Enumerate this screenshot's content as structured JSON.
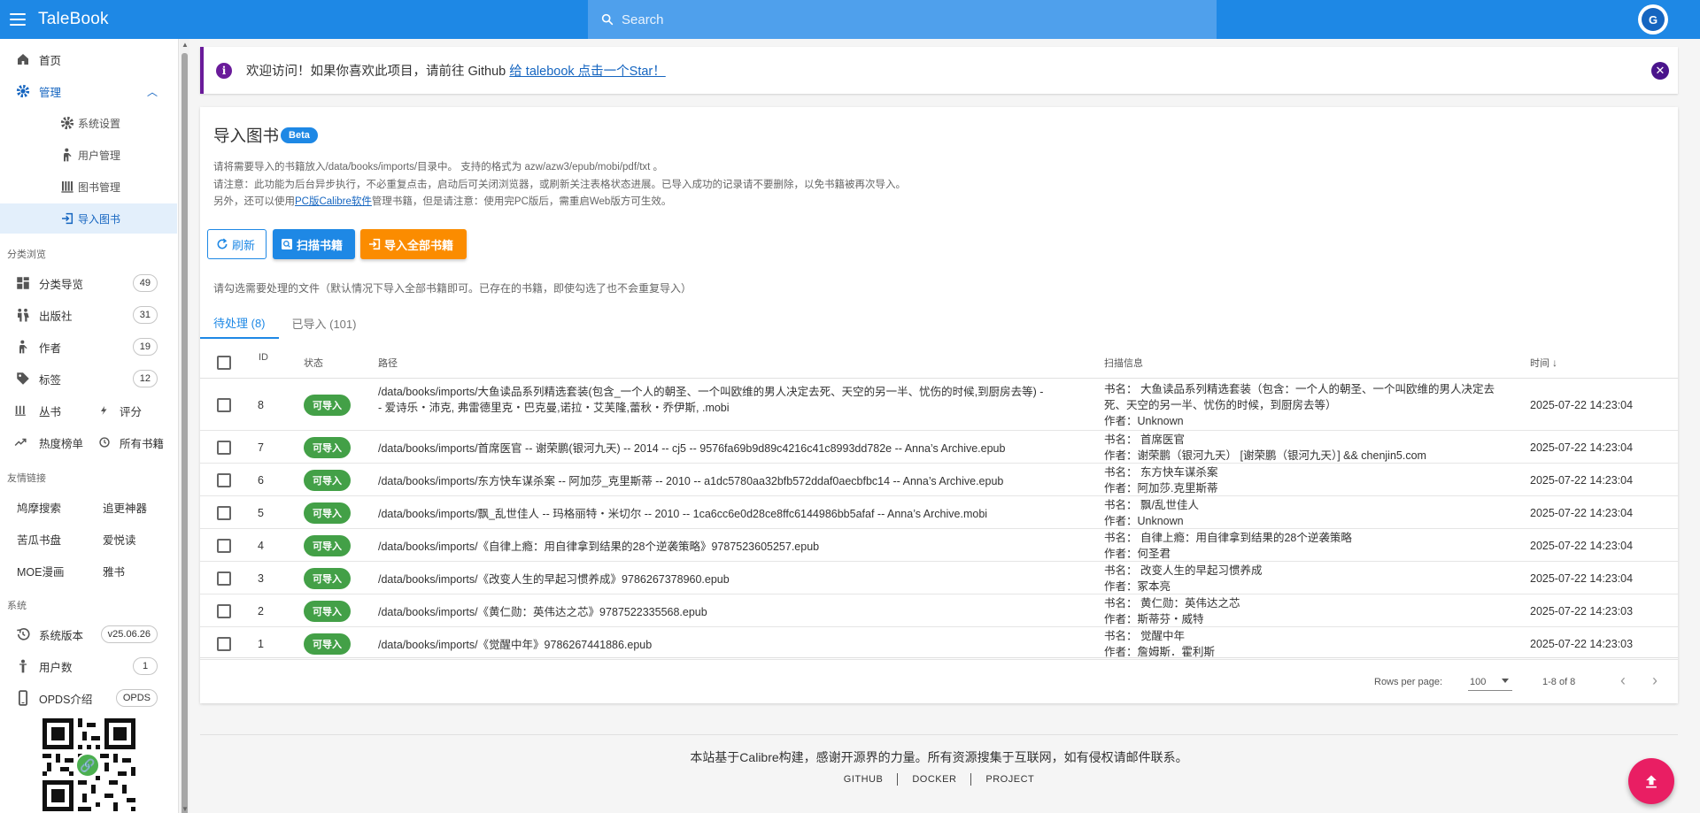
{
  "topbar": {
    "brand": "TaleBook",
    "search_placeholder": "Search",
    "avatar_letter": "G"
  },
  "sidebar": {
    "home": "首页",
    "manage": "管理",
    "manage_sub": [
      "系统设置",
      "用户管理",
      "图书管理",
      "导入图书"
    ],
    "section_browse": "分类浏览",
    "browse": [
      {
        "label": "分类导览",
        "count": "49"
      },
      {
        "label": "出版社",
        "count": "31"
      },
      {
        "label": "作者",
        "count": "19"
      },
      {
        "label": "标签",
        "count": "12"
      }
    ],
    "congshu": "丛书",
    "pingfen": "评分",
    "rebang": "热度榜单",
    "all_books": "所有书籍",
    "section_friends": "友情链接",
    "friends": [
      "鸠摩搜索",
      "追更神器",
      "苦瓜书盘",
      "爱悦读",
      "MOE漫画",
      "雅书"
    ],
    "section_system": "系统",
    "system": [
      {
        "label": "系统版本",
        "badge": "v25.06.26"
      },
      {
        "label": "用户数",
        "badge": "1"
      },
      {
        "label": "OPDS介绍",
        "badge": "OPDS"
      }
    ]
  },
  "alert": {
    "text": "欢迎访问！如果你喜欢此项目，请前往 Github ",
    "link": "给 talebook 点击一个Star！"
  },
  "import": {
    "title": "导入图书",
    "badge": "Beta",
    "desc1": "请将需要导入的书籍放入/data/books/imports/目录中。 支持的格式为 azw/azw3/epub/mobi/pdf/txt 。",
    "desc2": "请注意：此功能为后台异步执行，不必重复点击，启动后可关闭浏览器，或刷新关注表格状态进展。已导入成功的记录请不要删除，以免书籍被再次导入。",
    "desc3_pre": "另外，还可以使用",
    "desc3_link": "PC版Calibre软件",
    "desc3_post": "管理书籍，但是请注意：使用完PC版后，需重启Web版方可生效。",
    "btn_refresh": "刷新",
    "btn_scan": "扫描书籍",
    "btn_import_all": "导入全部书籍",
    "hint": "请勾选需要处理的文件（默认情况下导入全部书籍即可。已存在的书籍，即使勾选了也不会重复导入）",
    "tab_pending": "待处理 (8)",
    "tab_done": "已导入 (101)",
    "headers": {
      "id": "ID",
      "status": "状态",
      "path": "路径",
      "scan": "扫描信息",
      "time": "时间"
    },
    "rows": [
      {
        "id": "8",
        "status": "可导入",
        "path1": "/data/books/imports/大鱼读品系列精选套装(包含_一个人的朝圣、一个叫欧维的男人决定去死、天空的另一半、忧伤的时候,到厨房去等) -",
        "path2": "- 爱诗乐・沛克, 弗雷德里克・巴克曼,诺拉・艾芙隆,蕾秋・乔伊斯, .mobi",
        "scan1": "书名： 大鱼读品系列精选套装（包含：一个人的朝圣、一个叫欧维的男人决定去",
        "scan2": "死、天空的另一半、忧伤的时候，到厨房去等）",
        "scan3": "作者：Unknown",
        "time": "2025-07-22 14:23:04"
      },
      {
        "id": "7",
        "status": "可导入",
        "path1": "/data/books/imports/首席医官 -- 谢荣鹏(银河九天) -- 2014 -- cj5 -- 9576fa69b9d89c4216c41c8993dd782e -- Anna’s Archive.epub",
        "scan1": "书名： 首席医官",
        "scan2": "作者：谢荣鹏（银河九天） [谢荣鹏（银河九天）] && chenjin5.com",
        "time": "2025-07-22 14:23:04"
      },
      {
        "id": "6",
        "status": "可导入",
        "path1": "/data/books/imports/东方快车谋杀案 -- 阿加莎_克里斯蒂 -- 2010 -- a1dc5780aa32bfb572ddaf0aecbfbc14 -- Anna’s Archive.epub",
        "scan1": "书名： 东方快车谋杀案",
        "scan2": "作者：阿加莎.克里斯蒂",
        "time": "2025-07-22 14:23:04"
      },
      {
        "id": "5",
        "status": "可导入",
        "path1": "/data/books/imports/飘_乱世佳人 -- 玛格丽特・米切尔 -- 2010 -- 1ca6cc6e0d28ce8ffc6144986bb5afaf -- Anna’s Archive.mobi",
        "scan1": "书名： 飘/乱世佳人",
        "scan2": "作者：Unknown",
        "time": "2025-07-22 14:23:04"
      },
      {
        "id": "4",
        "status": "可导入",
        "path1": "/data/books/imports/《自律上瘾：用自律拿到结果的28个逆袭策略》9787523605257.epub",
        "scan1": "书名： 自律上瘾：用自律拿到结果的28个逆袭策略",
        "scan2": "作者：何圣君",
        "time": "2025-07-22 14:23:04"
      },
      {
        "id": "3",
        "status": "可导入",
        "path1": "/data/books/imports/《改变人生的早起习惯养成》9786267378960.epub",
        "scan1": "书名： 改变人生的早起习惯养成",
        "scan2": "作者：冢本亮",
        "time": "2025-07-22 14:23:04"
      },
      {
        "id": "2",
        "status": "可导入",
        "path1": "/data/books/imports/《黄仁勋：英伟达之芯》9787522335568.epub",
        "scan1": "书名： 黄仁勋：英伟达之芯",
        "scan2": "作者：斯蒂芬・威特",
        "time": "2025-07-22 14:23:03"
      },
      {
        "id": "1",
        "status": "可导入",
        "path1": "/data/books/imports/《觉醒中年》9786267441886.epub",
        "scan1": "书名： 觉醒中年",
        "scan2": "作者：詹姆斯．霍利斯",
        "time": "2025-07-22 14:23:03"
      }
    ],
    "rows_per_page_label": "Rows per page:",
    "rows_per_page": "100",
    "range": "1-8 of 8"
  },
  "footer": {
    "line": "本站基于Calibre构建，感谢开源界的力量。所有资源搜集于互联网，如有侵权请邮件联系。",
    "links": [
      "GITHUB",
      "DOCKER",
      "PROJECT"
    ]
  },
  "colors": {
    "primary": "#1e88e5",
    "orange": "#fb8c00",
    "green": "#43a047",
    "purple": "#6a1b9a",
    "fab": "#e91e63"
  }
}
